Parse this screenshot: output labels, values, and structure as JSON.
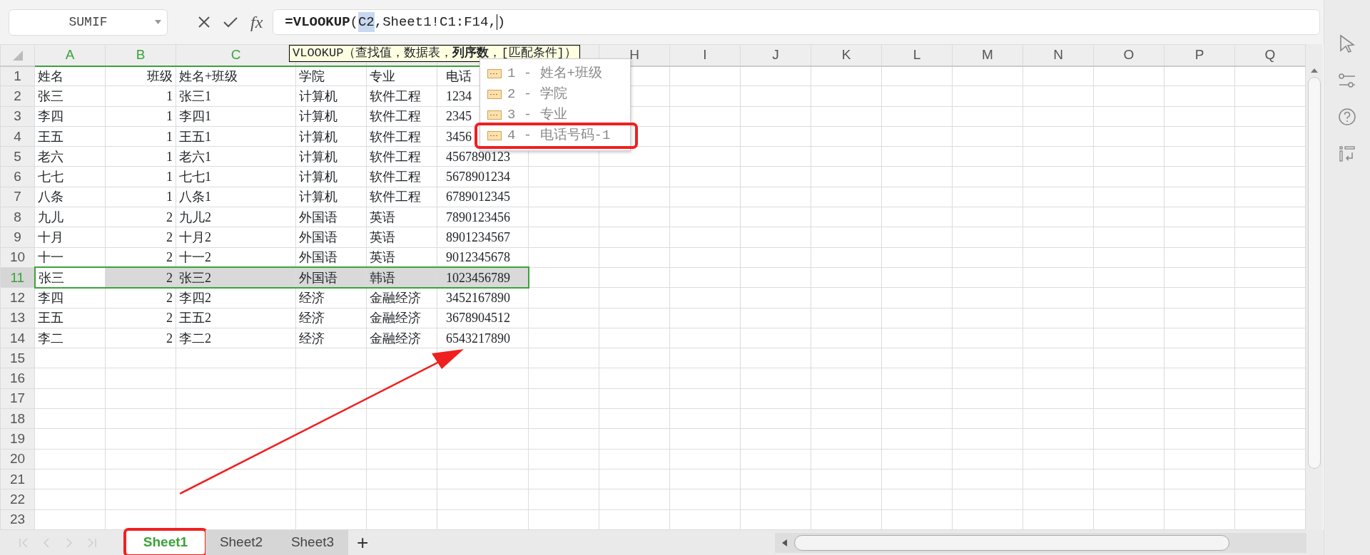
{
  "name_box": {
    "value": "SUMIF"
  },
  "formula_bar": {
    "fx": "fx",
    "formula": [
      {
        "text": "=VLOOKUP",
        "bold": true
      },
      {
        "text": "("
      },
      {
        "text": "C2",
        "highlighted": true
      },
      {
        "text": ",Sheet1!C1:F14,"
      },
      {
        "text": ")",
        "cursor_before": true
      }
    ]
  },
  "tooltip": {
    "text": "VLOOKUP（查找值，数据表，**列序数**，[匹配条件]）"
  },
  "dropdown": {
    "items": [
      {
        "label": "1 - 姓名+班级",
        "annotated": false
      },
      {
        "label": "2 - 学院",
        "annotated": false
      },
      {
        "label": "3 - 专业",
        "annotated": false
      },
      {
        "label": "4 - 电话号码-1",
        "annotated": true
      }
    ]
  },
  "columns": [
    {
      "label": "A",
      "selected": true
    },
    {
      "label": "B",
      "selected": true
    },
    {
      "label": "C",
      "selected": true
    },
    {
      "selected": true
    },
    {
      "selected": true
    },
    {
      "selected": true
    },
    {},
    {
      "label": "H",
      "selected": false
    },
    {
      "label": "I",
      "selected": false
    },
    {
      "label": "J",
      "selected": false
    },
    {
      "label": "K",
      "selected": false
    },
    {
      "label": "L",
      "selected": false
    },
    {
      "label": "M",
      "selected": false
    },
    {
      "label": "N",
      "selected": false
    },
    {
      "label": "O",
      "selected": false
    },
    {
      "label": "P",
      "selected": false
    },
    {
      "label": "Q",
      "selected": false
    }
  ],
  "rows": [
    {
      "label": "1",
      "selected": false,
      "cells": [
        "姓名",
        "班级",
        "姓名+班级",
        "学院",
        "专业",
        "电话"
      ]
    },
    {
      "label": "2",
      "selected": false,
      "cells": [
        "张三",
        "1",
        "张三1",
        "计算机",
        "软件工程",
        "1234"
      ]
    },
    {
      "label": "3",
      "selected": false,
      "cells": [
        "李四",
        "1",
        "李四1",
        "计算机",
        "软件工程",
        "2345"
      ]
    },
    {
      "label": "4",
      "selected": false,
      "cells": [
        "王五",
        "1",
        "王五1",
        "计算机",
        "软件工程",
        "3456"
      ]
    },
    {
      "label": "5",
      "selected": false,
      "cells": [
        "老六",
        "1",
        "老六1",
        "计算机",
        "软件工程",
        "4567890123"
      ]
    },
    {
      "label": "6",
      "selected": false,
      "cells": [
        "七七",
        "1",
        "七七1",
        "计算机",
        "软件工程",
        "5678901234"
      ]
    },
    {
      "label": "7",
      "selected": false,
      "cells": [
        "八条",
        "1",
        "八条1",
        "计算机",
        "软件工程",
        "6789012345"
      ]
    },
    {
      "label": "8",
      "selected": false,
      "cells": [
        "九儿",
        "2",
        "九儿2",
        "外国语",
        "英语",
        "7890123456"
      ]
    },
    {
      "label": "9",
      "selected": false,
      "cells": [
        "十月",
        "2",
        "十月2",
        "外国语",
        "英语",
        "8901234567"
      ]
    },
    {
      "label": "10",
      "selected": false,
      "cells": [
        "十一",
        "2",
        "十一2",
        "外国语",
        "英语",
        "9012345678"
      ]
    },
    {
      "label": "11",
      "selected": true,
      "cells": [
        "张三",
        "2",
        "张三2",
        "外国语",
        "韩语",
        "1023456789"
      ]
    },
    {
      "label": "12",
      "selected": false,
      "cells": [
        "李四",
        "2",
        "李四2",
        "经济",
        "金融经济",
        "3452167890"
      ]
    },
    {
      "label": "13",
      "selected": false,
      "cells": [
        "王五",
        "2",
        "王五2",
        "经济",
        "金融经济",
        "3678904512"
      ]
    },
    {
      "label": "14",
      "selected": false,
      "cells": [
        "李二",
        "2",
        "李二2",
        "经济",
        "金融经济",
        "6543217890"
      ]
    },
    {
      "label": "15",
      "selected": false
    },
    {
      "label": "16",
      "selected": false
    },
    {
      "label": "17",
      "selected": false
    },
    {
      "label": "18",
      "selected": false
    },
    {
      "label": "19",
      "selected": false
    },
    {
      "label": "20",
      "selected": false
    },
    {
      "label": "21",
      "selected": false
    },
    {
      "label": "22",
      "selected": false
    },
    {
      "label": "23",
      "selected": false
    }
  ],
  "sheet_tabs": [
    {
      "label": "Sheet1",
      "selected": true,
      "annotated": true
    },
    {
      "label": "Sheet2",
      "selected": false,
      "annotated": false
    },
    {
      "label": "Sheet3",
      "selected": false,
      "annotated": false
    }
  ],
  "add_sheet_button": "+"
}
